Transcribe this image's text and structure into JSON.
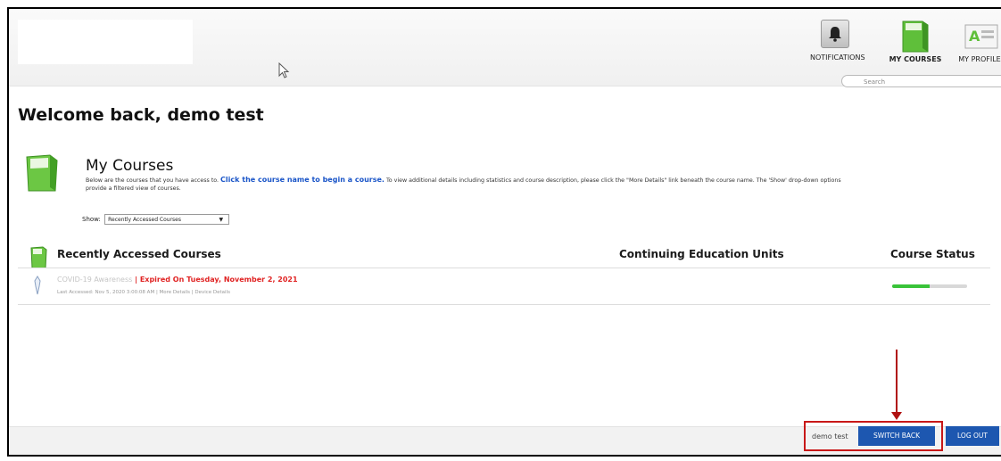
{
  "nav": {
    "notifications_label": "NOTIFICATIONS",
    "my_courses_label": "MY COURSES",
    "my_profile_label": "MY PROFILE",
    "search_placeholder": "Search"
  },
  "welcome": "Welcome back, demo test",
  "my_courses": {
    "title": "My Courses",
    "desc_prefix": "Below are the courses that you have access to. ",
    "desc_link": "Click the course name to begin a course.",
    "desc_suffix": " To view additional details including statistics and course description, please click the \"More Details\" link beneath the course name. The 'Show' drop-down options",
    "desc_line2": "provide a filtered view of courses.",
    "show_label": "Show:",
    "show_selected": "Recently Accessed Courses"
  },
  "table": {
    "col_courses": "Recently Accessed Courses",
    "col_ceu": "Continuing Education Units",
    "col_status": "Course Status"
  },
  "course": {
    "name": "COVID-19 Awareness",
    "separator": " | ",
    "expired": "Expired On Tuesday, November 2, 2021",
    "meta": "Last Accessed: Nov 5, 2020 3:00:08 AM | More Details | Device Details",
    "progress": 0.5,
    "progress_color": "#39c339"
  },
  "footer": {
    "user": "demo test",
    "switch_back": "SWITCH BACK",
    "log_out": "LOG OUT"
  },
  "colors": {
    "accent": "#1d57b0",
    "expired": "#e02323",
    "annotation": "#c81818"
  }
}
